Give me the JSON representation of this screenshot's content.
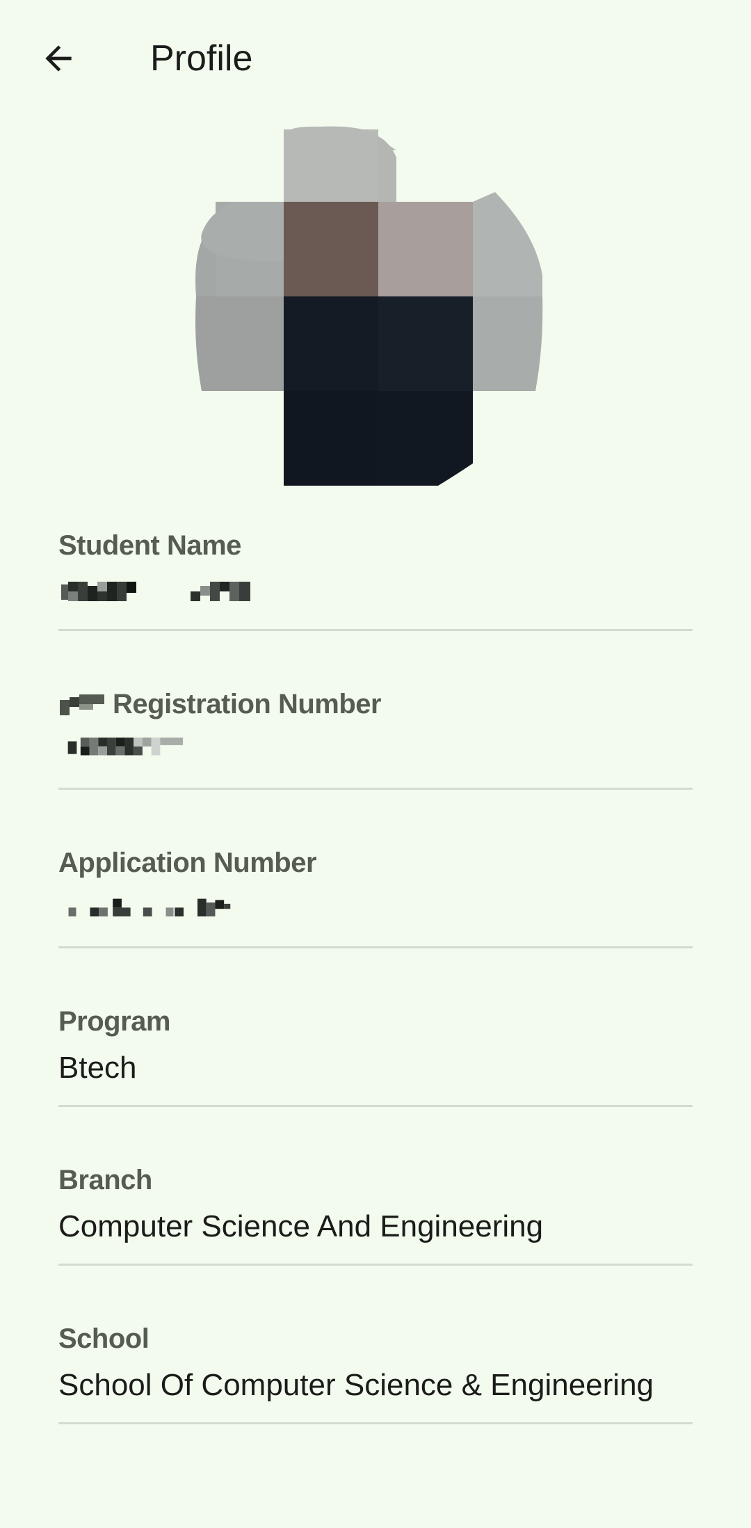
{
  "topbar": {
    "title": "Profile",
    "back_icon": "arrow-left-icon"
  },
  "avatar": {
    "icon": "profile-photo-pixelated"
  },
  "fields": [
    {
      "label": "Student Name",
      "value": ""
    },
    {
      "label": "Registration Number",
      "value": ""
    },
    {
      "label": "Application Number",
      "value": ""
    },
    {
      "label": "Program",
      "value": "Btech"
    },
    {
      "label": "Branch",
      "value": "Computer Science And Engineering"
    },
    {
      "label": "School",
      "value": "School Of Computer Science & Engineering"
    }
  ],
  "colors": {
    "background": "#f2fbee",
    "label": "#565c52",
    "value": "#1b1c19",
    "divider": "#d3dbce"
  }
}
